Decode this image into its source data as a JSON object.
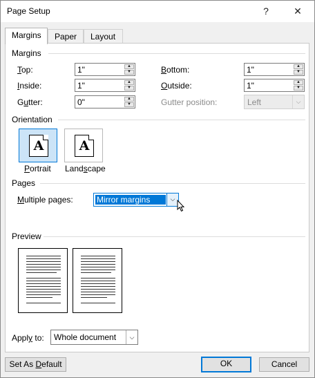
{
  "window": {
    "title": "Page Setup",
    "help_glyph": "?",
    "close_glyph": "✕"
  },
  "tabs": [
    {
      "label": "Margins",
      "active": true
    },
    {
      "label": "Paper",
      "active": false
    },
    {
      "label": "Layout",
      "active": false
    }
  ],
  "margins": {
    "section_title": "Margins",
    "top": {
      "label_ul": "T",
      "label_rest": "op:",
      "value": "1\""
    },
    "bottom": {
      "label_ul": "B",
      "label_rest": "ottom:",
      "value": "1\""
    },
    "inside": {
      "label_ul": "I",
      "label_rest": "nside:",
      "value": "1\""
    },
    "outside": {
      "label_ul": "O",
      "label_rest": "utside:",
      "value": "1\""
    },
    "gutter": {
      "label_pre": "G",
      "label_ul": "u",
      "label_rest": "tter:",
      "value": "0\""
    },
    "gutter_position": {
      "label": "Gutter position:",
      "value": "Left",
      "disabled": true
    }
  },
  "orientation": {
    "section_title": "Orientation",
    "portrait": {
      "label_ul": "P",
      "label_rest": "ortrait",
      "glyph": "A",
      "selected": true
    },
    "landscape": {
      "label_pre": "Land",
      "label_ul": "s",
      "label_rest": "cape",
      "glyph": "A",
      "selected": false
    }
  },
  "pages": {
    "section_title": "Pages",
    "multiple_pages": {
      "label_ul": "M",
      "label_rest": "ultiple pages:",
      "value": "Mirror margins"
    }
  },
  "preview": {
    "section_title": "Preview"
  },
  "apply_to": {
    "label_pre": "Appl",
    "label_ul": "y",
    "label_rest": " to:",
    "value": "Whole document"
  },
  "buttons": {
    "set_default_pre": "Set As ",
    "set_default_ul": "D",
    "set_default_rest": "efault",
    "ok": "OK",
    "cancel": "Cancel"
  },
  "colors": {
    "accent": "#0078d7",
    "dialog_bg": "#f0f0f0",
    "panel_bg": "#ffffff"
  }
}
